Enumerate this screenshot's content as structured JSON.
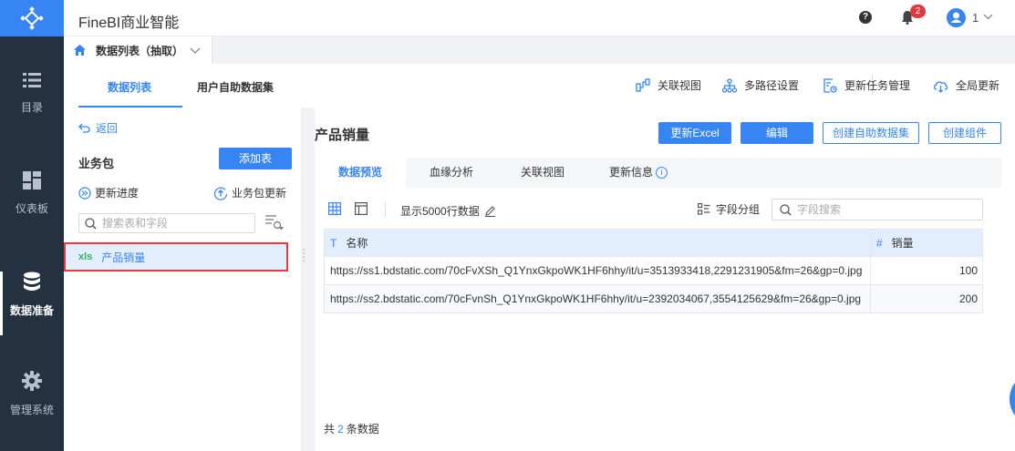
{
  "app": {
    "title": "FineBI商业智能"
  },
  "sidebar": {
    "items": [
      {
        "label": "目录",
        "icon": "list-icon"
      },
      {
        "label": "仪表板",
        "icon": "dashboard-icon"
      },
      {
        "label": "数据准备",
        "icon": "database-icon",
        "active": true
      },
      {
        "label": "管理系统",
        "icon": "gear-icon"
      }
    ]
  },
  "header": {
    "help": "?",
    "notification_count": "2",
    "user": "1"
  },
  "doc_tab": {
    "label": "数据列表（抽取）"
  },
  "left_tabs": [
    {
      "label": "数据列表",
      "active": true
    },
    {
      "label": "用户自助数据集"
    }
  ],
  "toolbar": {
    "related_view": "关联视图",
    "multipath": "多路径设置",
    "update_task": "更新任务管理",
    "global_update": "全局更新"
  },
  "left_panel": {
    "back": "返回",
    "package_title": "业务包",
    "add_table": "添加表",
    "update_progress": "更新进度",
    "package_update": "业务包更新",
    "search_placeholder": "搜索表和字段",
    "tables": [
      {
        "label": "产品销量",
        "icon": "xls-icon"
      }
    ]
  },
  "main": {
    "title": "产品销量",
    "buttons": {
      "update_excel": "更新Excel",
      "edit": "编辑",
      "create_dataset": "创建自助数据集",
      "create_component": "创建组件"
    },
    "tabs": [
      {
        "label": "数据预览",
        "active": true
      },
      {
        "label": "血缘分析"
      },
      {
        "label": "关联视图"
      },
      {
        "label": "更新信息"
      }
    ],
    "row_limit": "显示5000行数据",
    "field_group": "字段分组",
    "field_search_placeholder": "字段搜索",
    "columns": [
      {
        "type": "T",
        "label": "名称"
      },
      {
        "type": "#",
        "label": "销量"
      }
    ],
    "rows": [
      {
        "name": "https://ss1.bdstatic.com/70cFvXSh_Q1YnxGkpoWK1HF6hhy/it/u=3513933418,2291231905&fm=26&gp=0.jpg",
        "sales": "100"
      },
      {
        "name": "https://ss2.bdstatic.com/70cFvnSh_Q1YnxGkpoWK1HF6hhy/it/u=2392034067,3554125629&fm=26&gp=0.jpg",
        "sales": "200"
      }
    ],
    "total_prefix": "共",
    "total_count": "2",
    "total_suffix": "条数据"
  },
  "colors": {
    "accent": "#3685f2",
    "sidebar": "#243141",
    "danger": "#e0393e"
  }
}
